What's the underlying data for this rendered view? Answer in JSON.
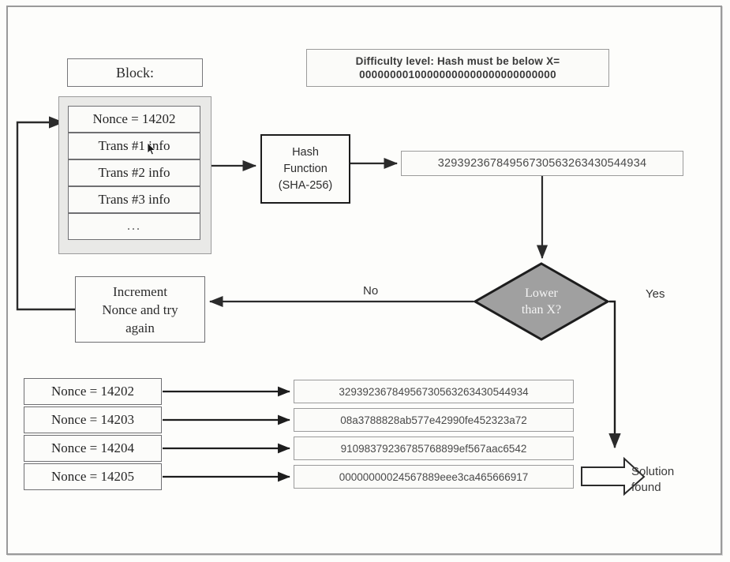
{
  "diagram": {
    "title_block": "Block:",
    "block_rows": [
      {
        "id": "nonce",
        "text": "Nonce = 14202"
      },
      {
        "id": "trans1",
        "text": "Trans #1 info"
      },
      {
        "id": "trans2",
        "text": "Trans #2 info"
      },
      {
        "id": "trans3",
        "text": "Trans #3 info"
      },
      {
        "id": "ellipsis",
        "text": "..."
      }
    ],
    "difficulty": {
      "line1": "Difficulty level: Hash must be below X=",
      "line2": "00000000100000000000000000000000"
    },
    "hash_function": {
      "line1": "Hash",
      "line2": "Function",
      "line3": "(SHA-256)"
    },
    "hash_output": "32939236784956730563263430544934",
    "decision": {
      "line1": "Lower",
      "line2": "than X?",
      "fill_color": "#a0a0a0"
    },
    "labels": {
      "no": "No",
      "yes": "Yes"
    },
    "increment": {
      "line1": "Increment",
      "line2": "Nonce and try",
      "line3": "again"
    },
    "attempts": [
      {
        "nonce": "Nonce = 14202",
        "hash": "32939236784956730563263430544934"
      },
      {
        "nonce": "Nonce = 14203",
        "hash": "08a3788828ab577e42990fe452323a72"
      },
      {
        "nonce": "Nonce = 14204",
        "hash": "91098379236785768899ef567aac6542"
      },
      {
        "nonce": "Nonce = 14205",
        "hash": "00000000024567889eee3ca465666917"
      }
    ],
    "solution": {
      "line1": "Solution",
      "line2": "found"
    },
    "colors": {
      "frame": "#9a9a9a",
      "box_border": "#77777a",
      "thick_border": "#1d1d1d",
      "diamond_fill": "#a0a0a0",
      "background": "#fdfdfb",
      "text": "#2b2b2b"
    }
  }
}
